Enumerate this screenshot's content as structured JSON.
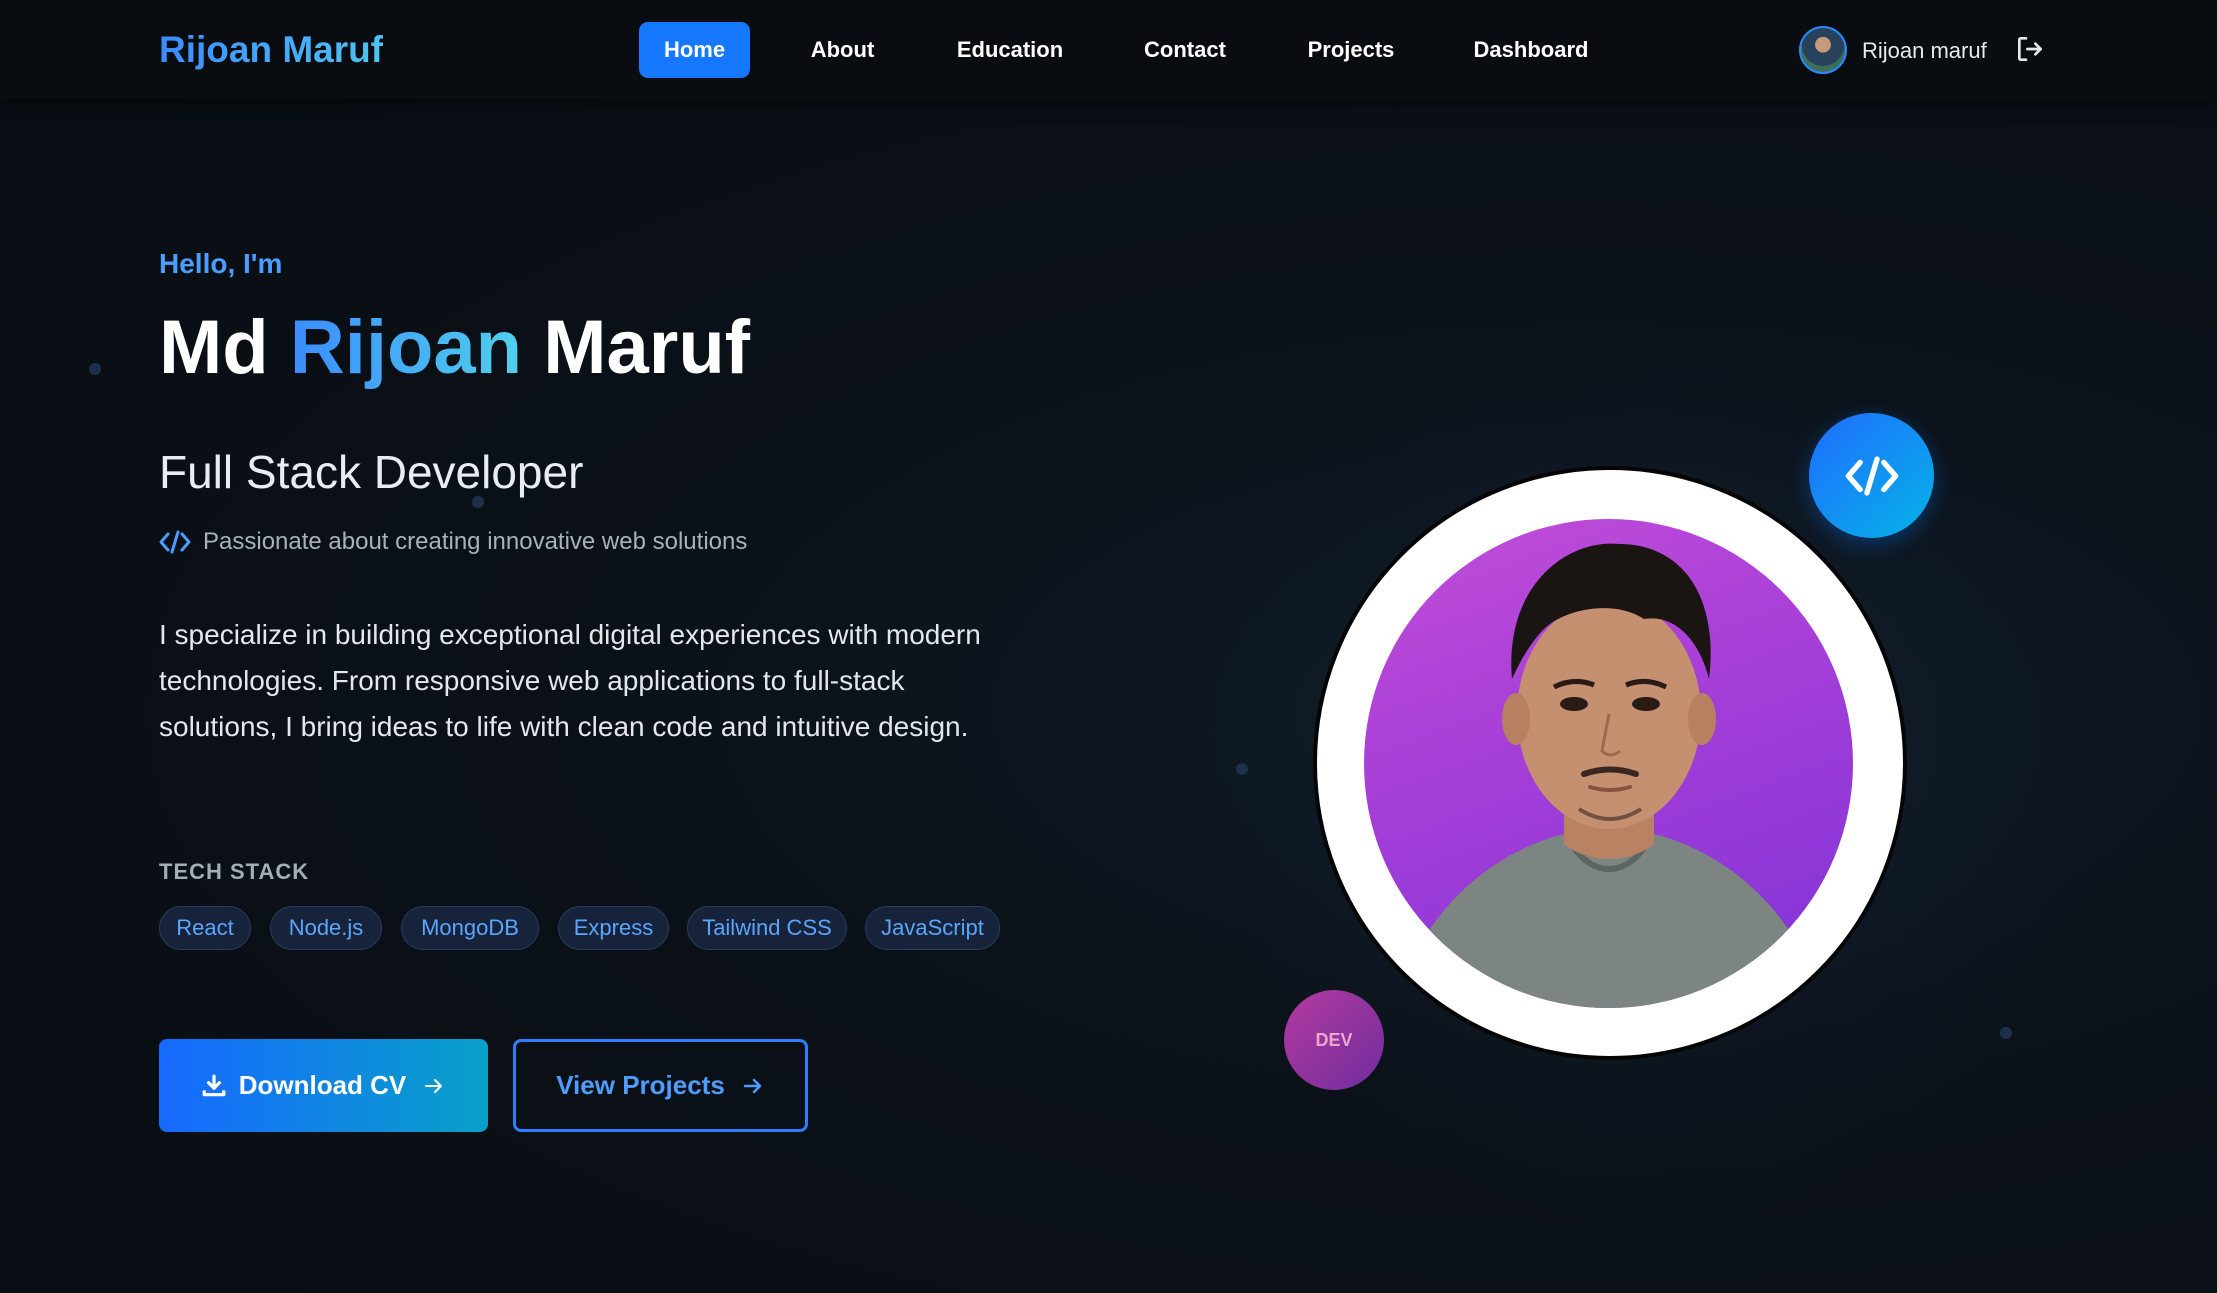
{
  "nav": {
    "logo": "Rijoan Maruf",
    "items": [
      {
        "label": "Home",
        "active": true
      },
      {
        "label": "About",
        "active": false
      },
      {
        "label": "Education",
        "active": false
      },
      {
        "label": "Contact",
        "active": false
      },
      {
        "label": "Projects",
        "active": false
      },
      {
        "label": "Dashboard",
        "active": false
      }
    ],
    "user_name": "Rijoan maruf",
    "logout_icon": "logout-icon"
  },
  "hero": {
    "greeting": "Hello, I'm",
    "name_first": "Md",
    "name_highlight": "Rijoan",
    "name_last": "Maruf",
    "role": "Full Stack Developer",
    "tagline": "Passionate about creating innovative web solutions",
    "bio": "I specialize in building exceptional digital experiences with modern technologies. From responsive web applications to full-stack solutions, I bring ideas to life with clean code and intuitive design.",
    "tech_title": "TECH STACK",
    "tech": [
      "React",
      "Node.js",
      "MongoDB",
      "Express",
      "Tailwind CSS",
      "JavaScript"
    ],
    "download_label": "Download CV",
    "projects_label": "View Projects"
  },
  "badges": {
    "code_icon": "code-icon",
    "dev_label": "DEV"
  },
  "colors": {
    "accent_blue": "#1677ff",
    "accent_cyan": "#4fd1ec",
    "background": "#0b1118",
    "chip_text": "#5aa6ff",
    "portrait_bg": "#a83fd8"
  }
}
